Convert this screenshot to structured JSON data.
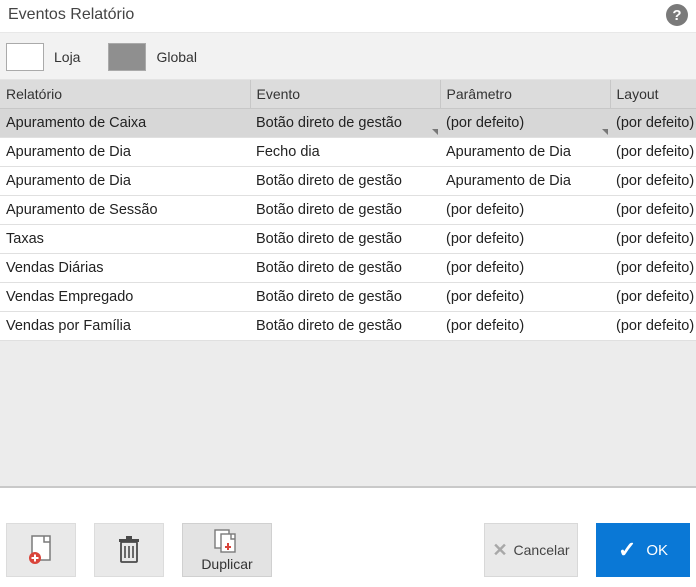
{
  "title": "Eventos Relatório",
  "scope": {
    "loja_label": "Loja",
    "global_label": "Global"
  },
  "columns": {
    "relatorio": "Relatório",
    "evento": "Evento",
    "parametro": "Parâmetro",
    "layout": "Layout"
  },
  "rows": [
    {
      "relatorio": "Apuramento de Caixa",
      "evento": "Botão direto de gestão",
      "parametro": "(por defeito)",
      "layout": "(por defeito)",
      "selected": true
    },
    {
      "relatorio": "Apuramento de Dia",
      "evento": "Fecho dia",
      "parametro": "Apuramento de Dia",
      "layout": "(por defeito)"
    },
    {
      "relatorio": "Apuramento de Dia",
      "evento": "Botão direto de gestão",
      "parametro": "Apuramento de Dia",
      "layout": "(por defeito)"
    },
    {
      "relatorio": "Apuramento de Sessão",
      "evento": "Botão direto de gestão",
      "parametro": "(por defeito)",
      "layout": "(por defeito)"
    },
    {
      "relatorio": "Taxas",
      "evento": "Botão direto de gestão",
      "parametro": "(por defeito)",
      "layout": "(por defeito)"
    },
    {
      "relatorio": "Vendas Diárias",
      "evento": "Botão direto de gestão",
      "parametro": "(por defeito)",
      "layout": "(por defeito)"
    },
    {
      "relatorio": "Vendas Empregado",
      "evento": "Botão direto de gestão",
      "parametro": "(por defeito)",
      "layout": "(por defeito)"
    },
    {
      "relatorio": "Vendas por Família",
      "evento": "Botão direto de gestão",
      "parametro": "(por defeito)",
      "layout": "(por defeito)"
    }
  ],
  "footer": {
    "duplicar": "Duplicar",
    "cancelar": "Cancelar",
    "ok": "OK"
  }
}
